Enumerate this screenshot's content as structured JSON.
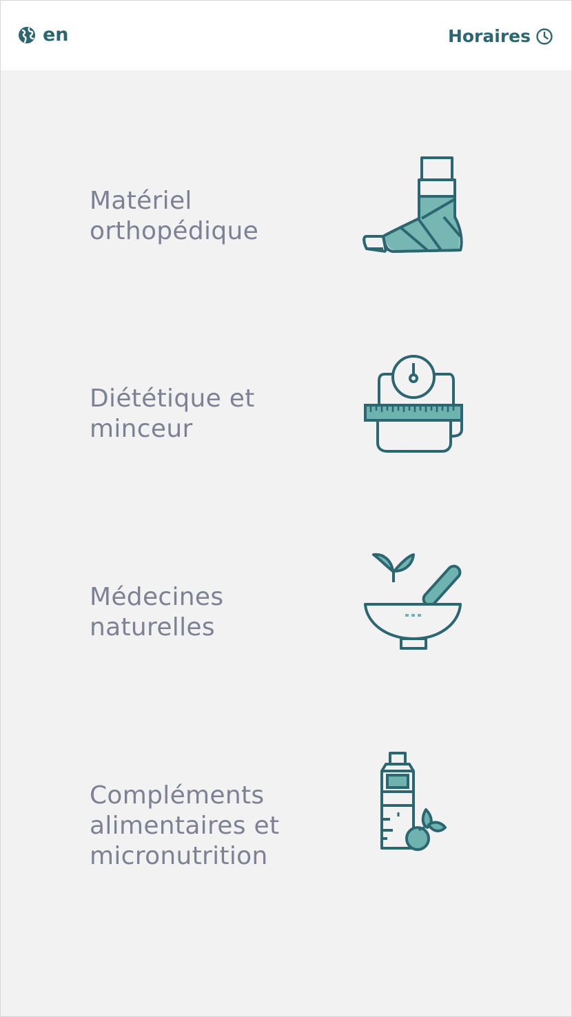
{
  "header": {
    "language_label": "en",
    "language_icon": "globe-icon",
    "hours_label": "Horaires",
    "hours_icon": "clock-icon"
  },
  "categories": [
    {
      "label": "Matériel\northopédique",
      "icon": "bandaged-foot-icon"
    },
    {
      "label": "Diététique et\nminceur",
      "icon": "scale-tape-measure-icon"
    },
    {
      "label": "Médecines\nnaturelles",
      "icon": "mortar-pestle-icon"
    },
    {
      "label": "Compléments\nalimentaires et\nmicronutrition",
      "icon": "supplement-bottle-icon"
    }
  ],
  "colors": {
    "accent": "#2c6670",
    "icon_fill": "#6fb3b0",
    "text_muted": "#7e8093",
    "background": "#f2f2f2",
    "header_background": "#ffffff"
  }
}
